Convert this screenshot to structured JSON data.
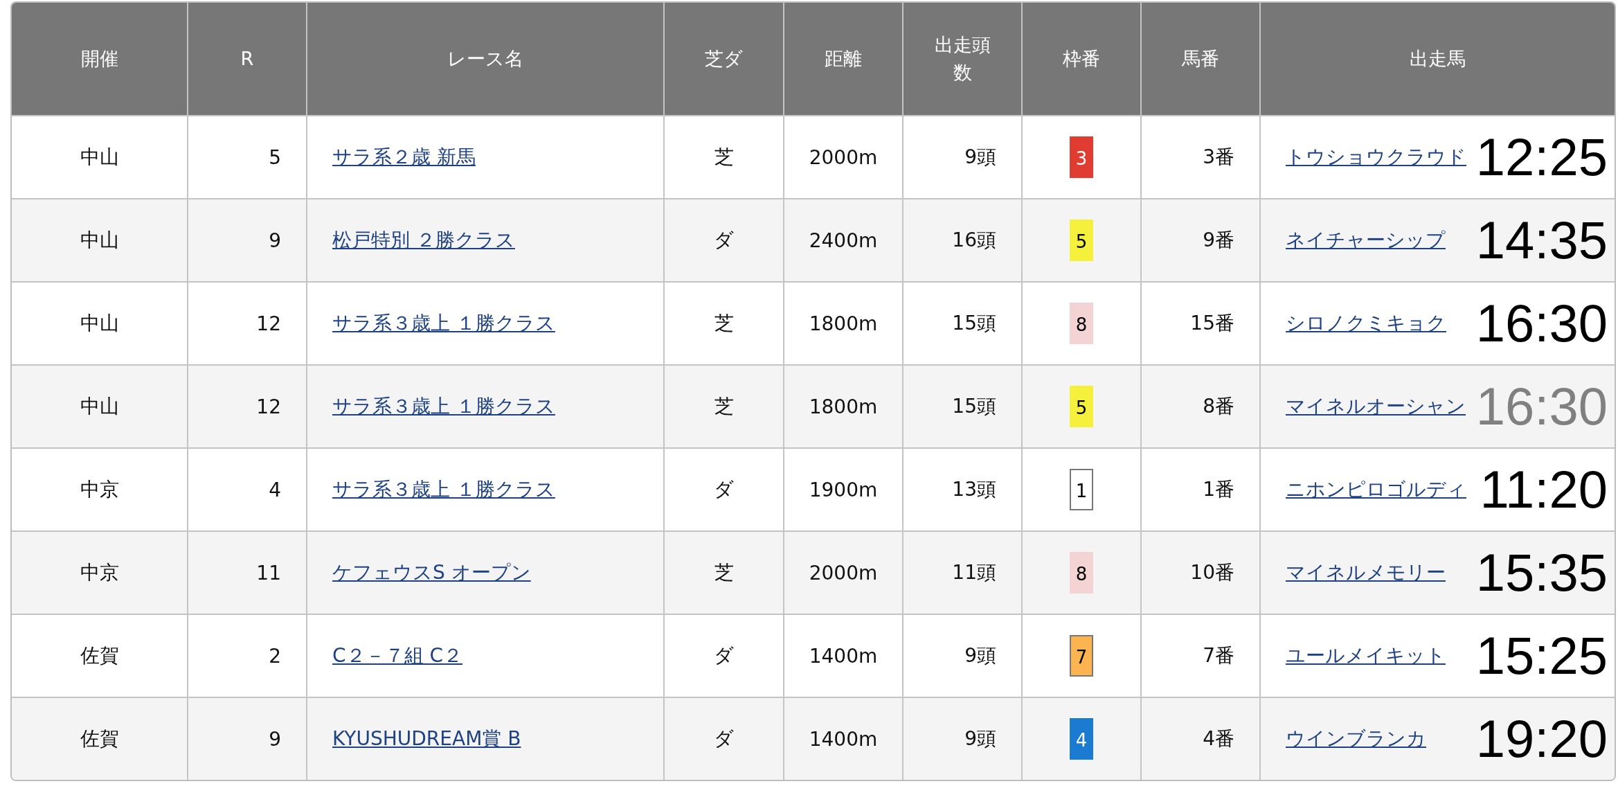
{
  "table": {
    "columns": [
      "開催",
      "R",
      "レース名",
      "芝ダ",
      "距離",
      "出走頭数",
      "枠番",
      "馬番",
      "出走馬"
    ],
    "rows": [
      {
        "venue": "中山",
        "race_no": "5",
        "race_name": "サラ系２歳 新馬",
        "surface": "芝",
        "distance": "2000m",
        "runners": "9頭",
        "frame": "3",
        "color": "#e03c31",
        "horse_no": "3番",
        "horse": "トウショウクラウド",
        "time": "12:25",
        "dimmed": false
      },
      {
        "venue": "中山",
        "race_no": "9",
        "race_name": "松戸特別 ２勝クラス",
        "surface": "ダ",
        "distance": "2400m",
        "runners": "16頭",
        "frame": "5",
        "color": "#f5f03c",
        "horse_no": "9番",
        "horse": "ネイチャーシップ",
        "time": "14:35",
        "dimmed": false
      },
      {
        "venue": "中山",
        "race_no": "12",
        "race_name": "サラ系３歳上 １勝クラス",
        "surface": "芝",
        "distance": "1800m",
        "runners": "15頭",
        "frame": "8",
        "color": "#f3d3d3",
        "horse_no": "15番",
        "horse": "シロノクミキョク",
        "time": "16:30",
        "dimmed": false
      },
      {
        "venue": "中山",
        "race_no": "12",
        "race_name": "サラ系３歳上 １勝クラス",
        "surface": "芝",
        "distance": "1800m",
        "runners": "15頭",
        "frame": "5",
        "color": "#f5f03c",
        "horse_no": "8番",
        "horse": "マイネルオーシャン",
        "time": "16:30",
        "dimmed": true
      },
      {
        "venue": "中京",
        "race_no": "4",
        "race_name": "サラ系３歳上 １勝クラス",
        "surface": "ダ",
        "distance": "1900m",
        "runners": "13頭",
        "frame": "1",
        "color": "#ffffff",
        "horse_no": "1番",
        "horse": "ニホンピロゴルディ",
        "time": "11:20",
        "dimmed": false
      },
      {
        "venue": "中京",
        "race_no": "11",
        "race_name": "ケフェウスS オープン",
        "surface": "芝",
        "distance": "2000m",
        "runners": "11頭",
        "frame": "8",
        "color": "#f3d3d3",
        "horse_no": "10番",
        "horse": "マイネルメモリー",
        "time": "15:35",
        "dimmed": false
      },
      {
        "venue": "佐賀",
        "race_no": "2",
        "race_name": "C２－７組 C２",
        "surface": "ダ",
        "distance": "1400m",
        "runners": "9頭",
        "frame": "7",
        "color": "#fbb450",
        "horse_no": "7番",
        "horse": "ユールメイキット",
        "time": "15:25",
        "dimmed": false
      },
      {
        "venue": "佐賀",
        "race_no": "9",
        "race_name": "KYUSHUDREAM賞 B",
        "surface": "ダ",
        "distance": "1400m",
        "runners": "9頭",
        "frame": "4",
        "color": "#1b7bd0",
        "horse_no": "4番",
        "horse": "ウインブランカ",
        "time": "19:20",
        "dimmed": false
      }
    ]
  }
}
